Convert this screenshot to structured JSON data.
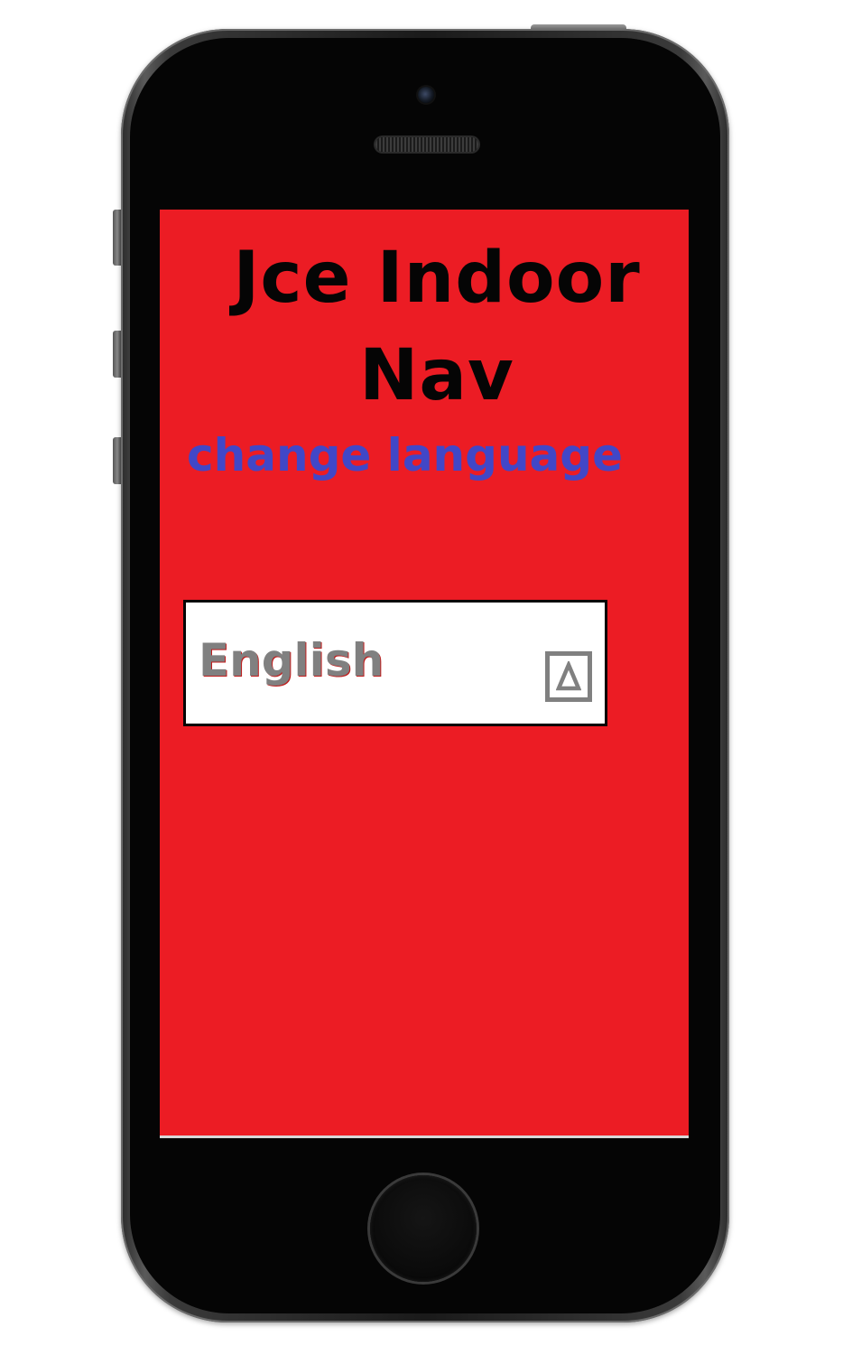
{
  "app": {
    "title": "Jce Indoor Nav",
    "subtitle": "change language"
  },
  "language_select": {
    "selected": "English",
    "arrow_icon": "triangle-up-icon"
  },
  "colors": {
    "screen_background": "#ec1c24",
    "title_text": "#050505",
    "subtitle_text": "#4147c7",
    "select_text": "#808080",
    "select_background": "#ffffff"
  }
}
